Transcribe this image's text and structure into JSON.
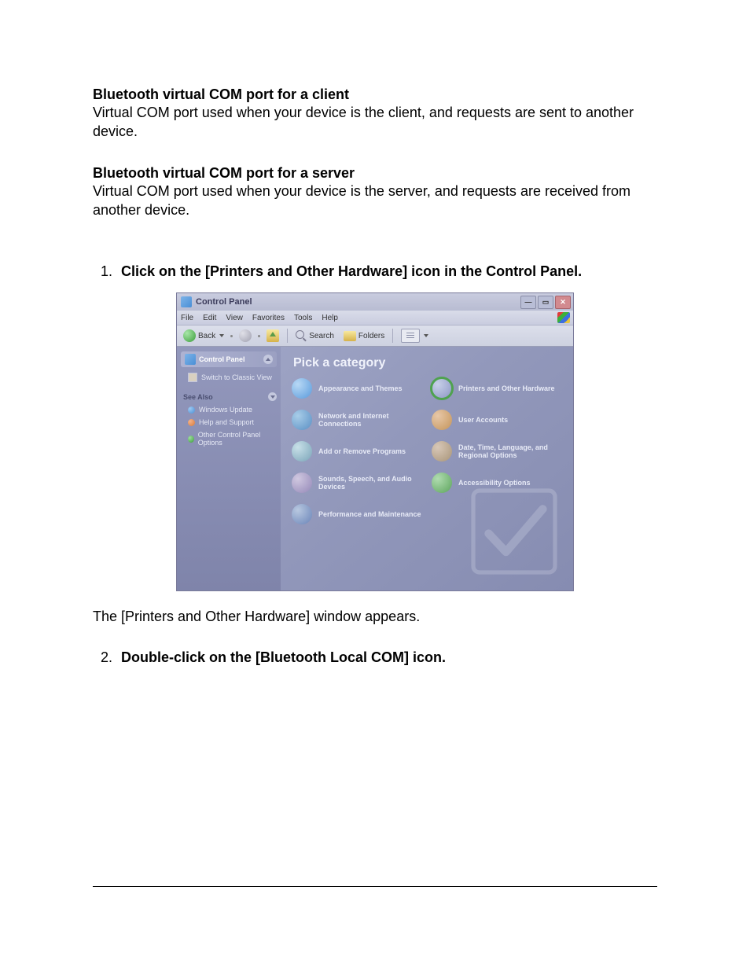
{
  "section1": {
    "heading": "Bluetooth virtual COM port for a client",
    "body": "Virtual COM port used when your device is the client, and requests are sent to another device."
  },
  "section2": {
    "heading": "Bluetooth virtual COM port for a server",
    "body": "Virtual COM port used when your device is the server, and requests are received from another device."
  },
  "steps": {
    "one": "Click on the [Printers and Other Hardware] icon in the Control Panel.",
    "after_one": "The [Printers and Other Hardware] window appears.",
    "two": "Double-click on the [Bluetooth Local COM] icon."
  },
  "window": {
    "title": "Control Panel",
    "menus": [
      "File",
      "Edit",
      "View",
      "Favorites",
      "Tools",
      "Help"
    ],
    "toolbar": {
      "back": "Back",
      "search": "Search",
      "folders": "Folders"
    },
    "sidebar": {
      "panel_header": "Control Panel",
      "switch_link": "Switch to Classic View",
      "see_also": "See Also",
      "items": [
        "Windows Update",
        "Help and Support",
        "Other Control Panel Options"
      ]
    },
    "content": {
      "pick": "Pick a category",
      "categories_left": [
        "Appearance and Themes",
        "Network and Internet Connections",
        "Add or Remove Programs",
        "Sounds, Speech, and Audio Devices",
        "Performance and Maintenance"
      ],
      "categories_right": [
        "Printers and Other Hardware",
        "User Accounts",
        "Date, Time, Language, and Regional Options",
        "Accessibility Options"
      ]
    }
  }
}
